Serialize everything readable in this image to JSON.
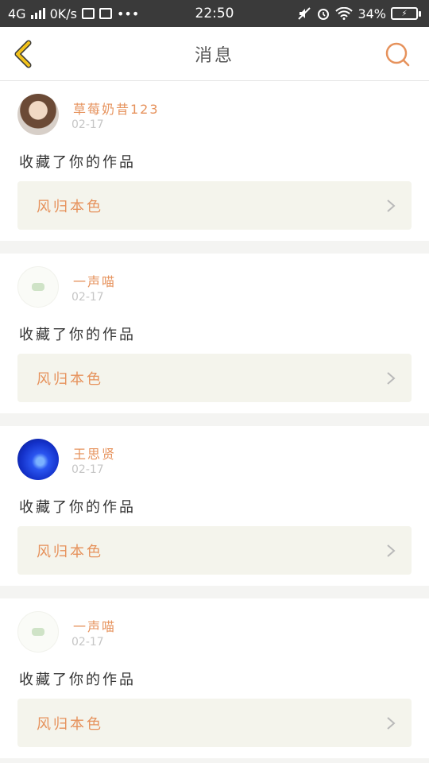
{
  "status_bar": {
    "network": "4G",
    "speed": "0K/s",
    "extra": "•••",
    "time": "22:50",
    "battery": "34%"
  },
  "header": {
    "title": "消息"
  },
  "messages": [
    {
      "username": "草莓奶昔123",
      "date": "02-17",
      "action": "收藏了你的作品",
      "work_title": "风归本色",
      "avatar": "photo-avatar"
    },
    {
      "username": "一声喵",
      "date": "02-17",
      "action": "收藏了你的作品",
      "work_title": "风归本色",
      "avatar": "bear-avatar"
    },
    {
      "username": "王思贤",
      "date": "02-17",
      "action": "收藏了你的作品",
      "work_title": "风归本色",
      "avatar": "jellyfish-avatar"
    },
    {
      "username": "一声喵",
      "date": "02-17",
      "action": "收藏了你的作品",
      "work_title": "风归本色",
      "avatar": "bear-avatar"
    }
  ],
  "colors": {
    "accent": "#e6925c",
    "back_icon": "#f2c21b",
    "work_box_bg": "#f4f4ec"
  }
}
